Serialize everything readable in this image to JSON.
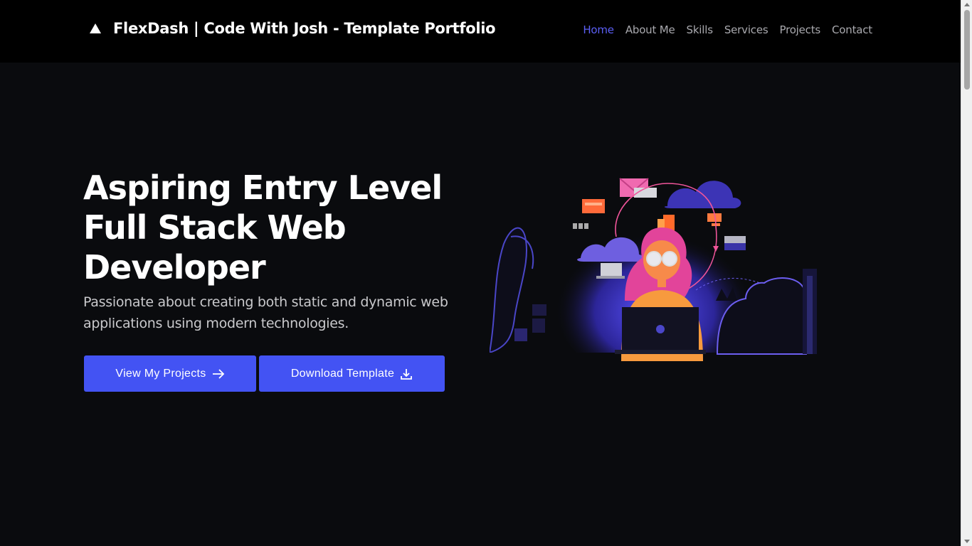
{
  "header": {
    "brand_title": "FlexDash | Code With Josh - Template Portfolio",
    "nav_items": [
      "Home",
      "About Me",
      "Skills",
      "Services",
      "Projects",
      "Contact"
    ],
    "active_item": "Home"
  },
  "hero": {
    "title_lines": [
      "Aspiring Entry Level",
      "Full Stack Web",
      "Developer"
    ],
    "subtitle": "Passionate about creating both static and dynamic web applications using modern technologies.",
    "primary_button": "View My Projects",
    "secondary_button": "Download Template"
  },
  "icons": {
    "brand": "triangle-logo-icon",
    "primary_button": "arrow-right-icon",
    "secondary_button": "download-icon"
  },
  "colors": {
    "accent": "#4353f3",
    "nav_active": "#5b5ff5",
    "background": "#0a0b0e",
    "navbar": "#000000"
  }
}
